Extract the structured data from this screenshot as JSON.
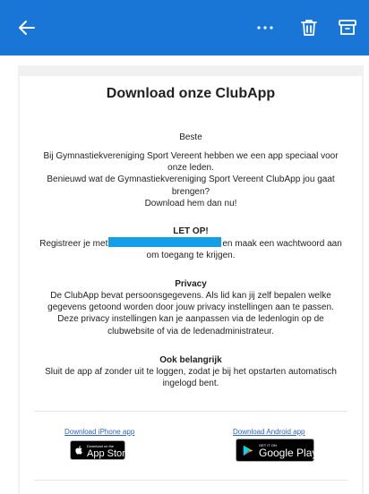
{
  "email": {
    "title": "Download onze ClubApp",
    "greeting": "Beste",
    "intro": [
      "Bij Gymnastiekvereniging Sport Vereent hebben we een app speciaal voor",
      "onze leden.",
      "Benieuwd wat de Gymnastiekvereniging Sport Vereent ClubApp jou gaat",
      "brengen?",
      "Download hem dan nu!"
    ],
    "notice": {
      "heading": "LET OP!",
      "before_redaction": "Registreer je met",
      "after_redaction": "en maak een wachtwoord aan",
      "line2": "om toegang te krijgen."
    },
    "privacy": {
      "heading": "Privacy",
      "lines": [
        "De ClubApp bevat persoonsgegevens. Als lid kan jij zelf bepalen welke",
        "gegevens getoond worden door jouw privacy instellingen aan te passen.",
        "Deze privacy instellingen kan je aanpassen via de ledenlogin op de",
        "clubwebsite of via de ledenadministrateur."
      ]
    },
    "important": {
      "heading": "Ook belangrijk",
      "lines": [
        "Sluit de app af zonder uit te loggen, zodat je bij het opstarten automatisch",
        "ingelogd bent."
      ]
    },
    "downloads": {
      "iphone_link": "Download iPhone app",
      "android_link": "Download Android app",
      "app_store_small": "Download on the",
      "app_store_big": "App Store",
      "google_play_small": "GET IT ON",
      "google_play_big": "Google Play"
    }
  },
  "colors": {
    "header": "#1976d6",
    "redaction": "#14a0e8",
    "link": "#2a64c9"
  }
}
